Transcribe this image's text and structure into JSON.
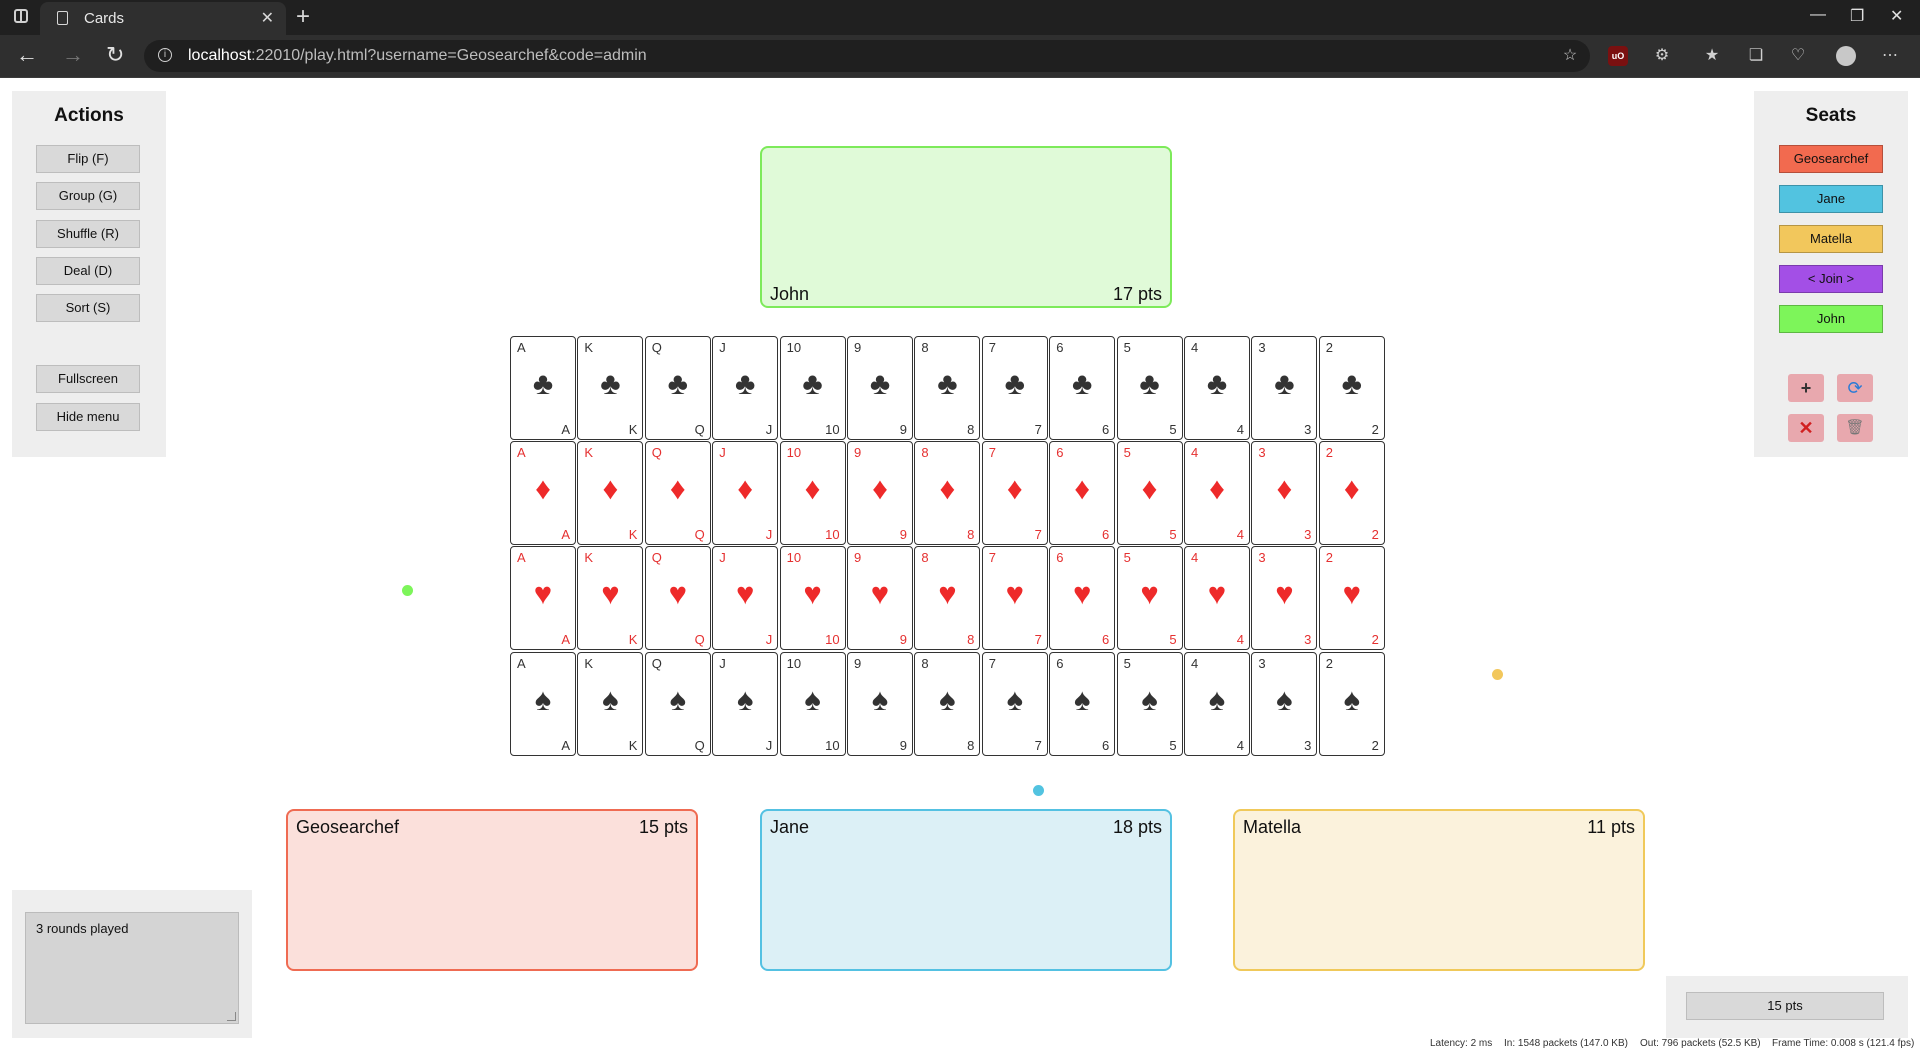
{
  "browser": {
    "tab_title": "Cards",
    "url_host": "localhost",
    "url_rest": ":22010/play.html?username=Geosearchef&code=admin"
  },
  "actions": {
    "title": "Actions",
    "buttons": [
      "Flip (F)",
      "Group (G)",
      "Shuffle (R)",
      "Deal (D)",
      "Sort (S)"
    ],
    "fullscreen": "Fullscreen",
    "hide_menu": "Hide menu"
  },
  "seats": {
    "title": "Seats",
    "list": [
      {
        "label": "Geosearchef",
        "color": "#f26a4f"
      },
      {
        "label": "Jane",
        "color": "#52c3e0"
      },
      {
        "label": "Matella",
        "color": "#f2c75c"
      },
      {
        "label": "< Join >",
        "color": "#a34fe6"
      },
      {
        "label": "John",
        "color": "#7df55a"
      }
    ],
    "icons": [
      "plus-icon",
      "refresh-icon",
      "close-icon",
      "trash-icon"
    ]
  },
  "players": {
    "john": {
      "name": "John",
      "points": "17 pts",
      "border": "#7dea5a",
      "fill": "#e0fad8"
    },
    "geosearchef": {
      "name": "Geosearchef",
      "points": "15 pts",
      "border": "#ef6b52",
      "fill": "#fbe0db"
    },
    "jane": {
      "name": "Jane",
      "points": "18 pts",
      "border": "#54c1e2",
      "fill": "#dcf0f6"
    },
    "matella": {
      "name": "Matella",
      "points": "11 pts",
      "border": "#f0c95a",
      "fill": "#fbf2dc"
    }
  },
  "deck": {
    "ranks": [
      "A",
      "K",
      "Q",
      "J",
      "10",
      "9",
      "8",
      "7",
      "6",
      "5",
      "4",
      "3",
      "2"
    ],
    "suits": [
      {
        "name": "clubs",
        "symbol": "♣",
        "color": "black"
      },
      {
        "name": "diamonds",
        "symbol": "♦",
        "color": "red"
      },
      {
        "name": "hearts",
        "symbol": "♥",
        "color": "red"
      },
      {
        "name": "spades",
        "symbol": "♠",
        "color": "black"
      }
    ]
  },
  "notes": {
    "text": "3 rounds played"
  },
  "score": {
    "label": "15 pts"
  },
  "status": {
    "latency": "Latency: 2 ms",
    "in": "In: 1548 packets (147.0 KB)",
    "out": "Out: 796 packets (52.5 KB)",
    "frame": "Frame Time: 0.008 s  (121.4 fps)"
  }
}
